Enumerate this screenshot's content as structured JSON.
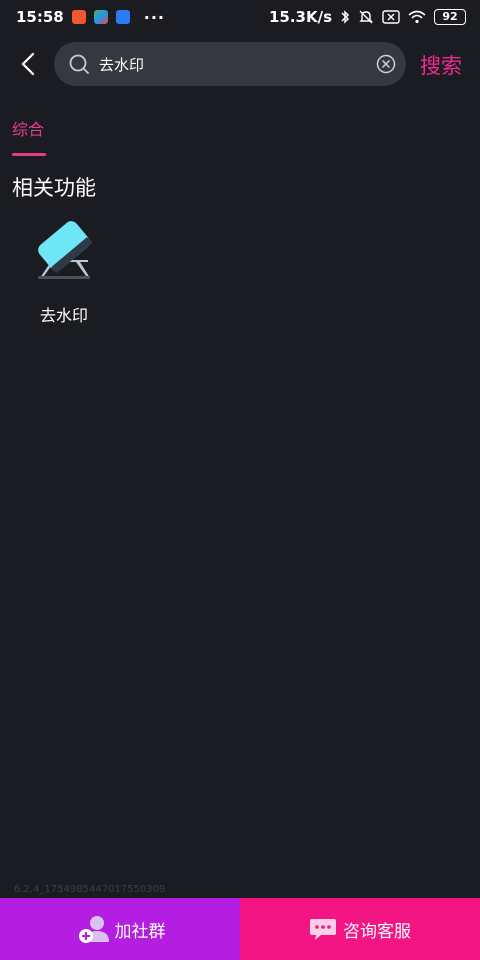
{
  "status_bar": {
    "time": "15:58",
    "more": "···",
    "network_speed": "15.3K/s",
    "battery": "92",
    "icons": [
      "app-orange-icon",
      "app-color-icon",
      "app-blue-icon",
      "bluetooth-icon",
      "mute-icon",
      "sim-off-icon",
      "wifi-icon",
      "battery-icon"
    ]
  },
  "header": {
    "back_icon": "chevron-left-icon",
    "search_query": "去水印",
    "clear_icon": "clear-circle-icon",
    "search_button": "搜索"
  },
  "tabs": [
    {
      "label": "综合",
      "active": true
    }
  ],
  "section": {
    "title": "相关功能",
    "items": [
      {
        "label": "去水印",
        "icon": "eraser-icon"
      }
    ]
  },
  "footer": {
    "version": "6.2.4_1754985447017550309"
  },
  "bottom_bar": {
    "left": {
      "label": "加社群",
      "icon": "group-add-icon"
    },
    "right": {
      "label": "咨询客服",
      "icon": "chat-bubble-icon"
    }
  },
  "colors": {
    "background": "#1b1c21",
    "accent": "#e33d8e",
    "group_button": "#b31ee0",
    "service_button": "#f31583",
    "search_box": "#36383f",
    "eraser": "#6ee6f5"
  }
}
